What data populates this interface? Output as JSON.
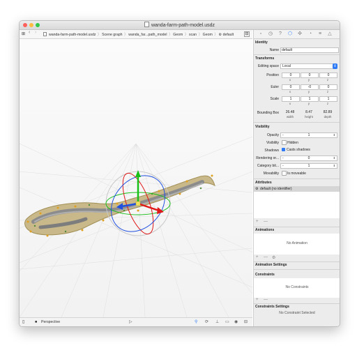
{
  "window": {
    "title": "wanda-farm-path-model.usdz",
    "traffic_lights": {
      "close": "#fc605b",
      "minimize": "#fdbc40",
      "zoom": "#34c84a"
    }
  },
  "navbar": {
    "breadcrumbs": [
      {
        "label": "wanda-farm-path-model.usdz",
        "icon": "doc-icon"
      },
      {
        "label": "Scene graph"
      },
      {
        "label": "wanda_far...path_model",
        "icon": "doc-icon"
      },
      {
        "label": "Geom"
      },
      {
        "label": "scan"
      },
      {
        "label": "Geom"
      },
      {
        "label": "default",
        "icon": "gear-icon"
      }
    ]
  },
  "viewport": {
    "camera_label": "Perspective",
    "gizmo_colors": {
      "x": "#e01818",
      "y": "#18c018",
      "z": "#2050e0",
      "rotate": "#c8c8c8"
    }
  },
  "inspector": {
    "identity": {
      "section": "Identity",
      "name_label": "Name",
      "name_value": "default"
    },
    "transforms": {
      "section": "Transforms",
      "editing_space_label": "Editing space",
      "editing_space_value": "Local",
      "position": {
        "label": "Position",
        "x": "0",
        "y": "0",
        "z": "0"
      },
      "euler": {
        "label": "Euler",
        "x": "0",
        "y": "-0",
        "z": "0"
      },
      "scale": {
        "label": "Scale",
        "x": "1",
        "y": "1",
        "z": "1"
      },
      "axis_labels": {
        "x": "x",
        "y": "y",
        "z": "z"
      },
      "bounding_box": {
        "label": "Bounding Box",
        "width": "26.48",
        "height": "8.47",
        "depth": "82.89",
        "width_label": "width",
        "height_label": "height",
        "depth_label": "depth"
      }
    },
    "visibility": {
      "section": "Visibility",
      "opacity_label": "Opacity",
      "opacity_dash": "-",
      "opacity_value": "1",
      "visibility_label": "Visibility",
      "visibility_value": "Hidden",
      "shadows_label": "Shadows",
      "shadows_value": "Casts shadows",
      "rendering_label": "Rendering or...",
      "rendering_dash": "-",
      "rendering_value": "0",
      "category_label": "Category bit...",
      "category_dash": "-",
      "category_value": "1",
      "movability_label": "Movability",
      "movability_value": "Is moveable"
    },
    "attributes": {
      "section": "Attributes",
      "row": "default (no identifier)"
    },
    "animations": {
      "section": "Animations",
      "empty": "No Animation"
    },
    "animation_settings": {
      "section": "Animation Settings"
    },
    "constraints": {
      "section": "Constraints",
      "empty": "No Constraints"
    },
    "constraints_settings": {
      "section": "Constraints Settings",
      "empty": "No Constraint Selected"
    },
    "add_glyph": "+",
    "remove_glyph": "—"
  }
}
